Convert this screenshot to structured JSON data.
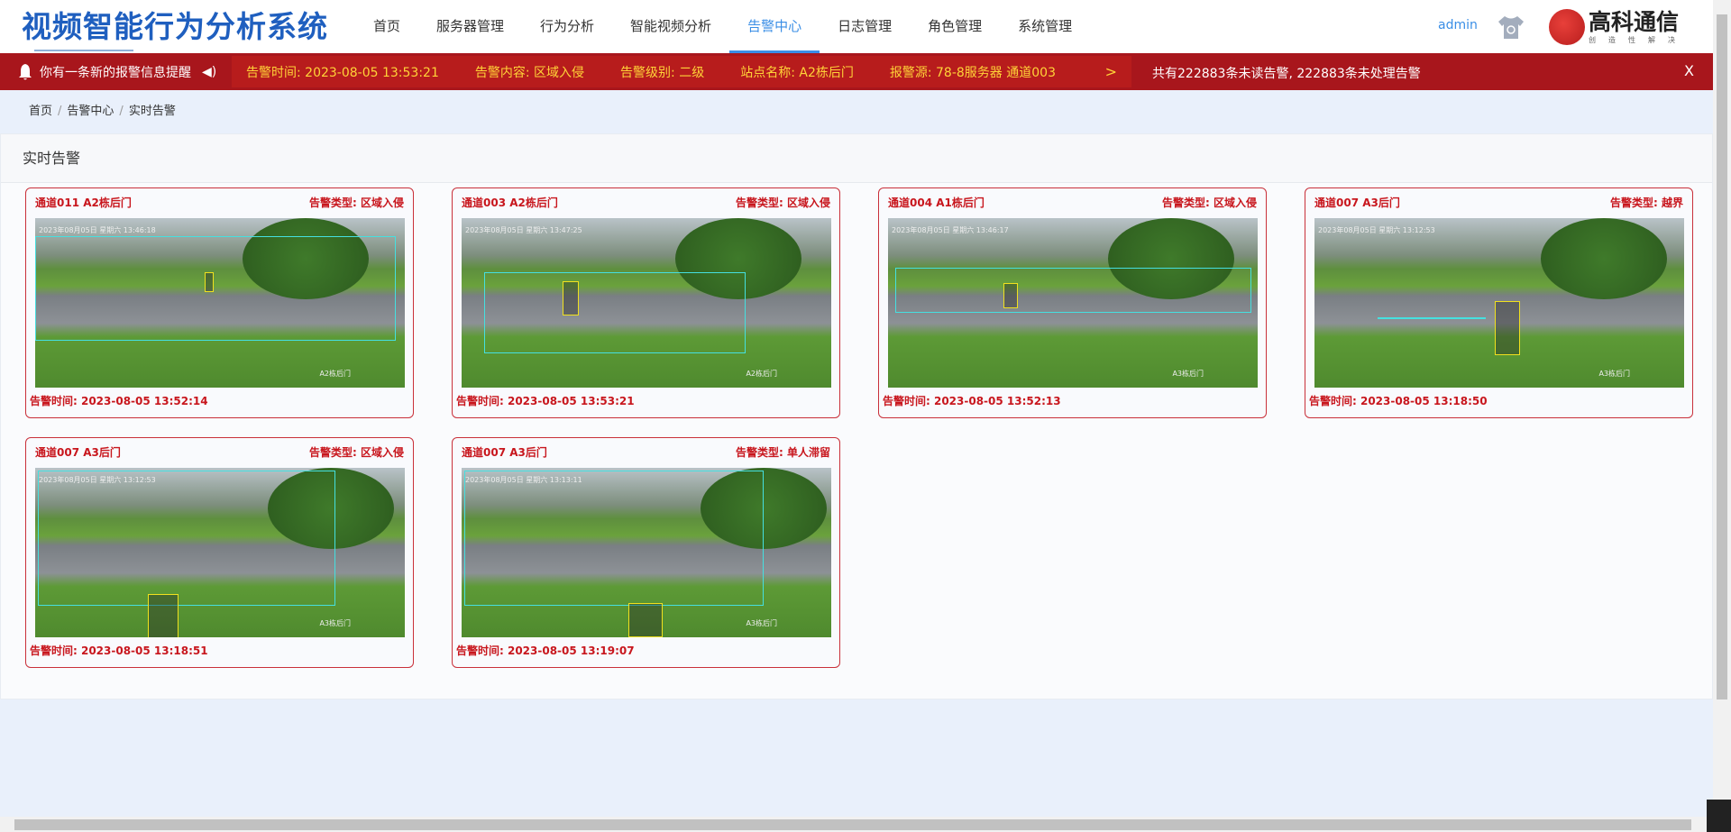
{
  "header": {
    "title": "视频智能行为分析系统",
    "nav": [
      "首页",
      "服务器管理",
      "行为分析",
      "智能视频分析",
      "告警中心",
      "日志管理",
      "角色管理",
      "系统管理"
    ],
    "active_nav": 4,
    "user": "admin",
    "logo_text": "高科通信",
    "logo_sub": "创造性解决"
  },
  "alert": {
    "message": "你有一条新的报警信息提醒",
    "time": "告警时间: 2023-08-05 13:53:21",
    "content": "告警内容: 区域入侵",
    "level": "告警级别: 二级",
    "site": "站点名称: A2栋后门",
    "source": "报警源: 78-8服务器 通道003",
    "summary": "共有222883条未读告警, 222883条未处理告警",
    "close": "X"
  },
  "breadcrumb": [
    "首页",
    "告警中心",
    "实时告警"
  ],
  "panel_title": "实时告警",
  "cards": [
    {
      "channel": "通道011   A2栋后门",
      "type": "告警类型: 区域入侵",
      "time": "告警时间: 2023-08-05 13:52:14",
      "osd": "2023年08月05日 星期六 13:46:18",
      "site": "A2栋后门"
    },
    {
      "channel": "通道003   A2栋后门",
      "type": "告警类型: 区域入侵",
      "time": "告警时间: 2023-08-05 13:53:21",
      "osd": "2023年08月05日 星期六 13:47:25",
      "site": "A2栋后门"
    },
    {
      "channel": "通道004   A1栋后门",
      "type": "告警类型: 区域入侵",
      "time": "告警时间: 2023-08-05 13:52:13",
      "osd": "2023年08月05日 星期六 13:46:17",
      "site": "A3栋后门"
    },
    {
      "channel": "通道007   A3后门",
      "type": "告警类型: 越界",
      "time": "告警时间: 2023-08-05 13:18:50",
      "osd": "2023年08月05日 星期六 13:12:53",
      "site": "A3栋后门"
    },
    {
      "channel": "通道007   A3后门",
      "type": "告警类型: 区域入侵",
      "time": "告警时间: 2023-08-05 13:18:51",
      "osd": "2023年08月05日 星期六 13:12:53",
      "site": "A3栋后门"
    },
    {
      "channel": "通道007   A3后门",
      "type": "告警类型: 单人滞留",
      "time": "告警时间: 2023-08-05 13:19:07",
      "osd": "2023年08月05日 星期六 13:13:11",
      "site": "A3栋后门"
    }
  ]
}
